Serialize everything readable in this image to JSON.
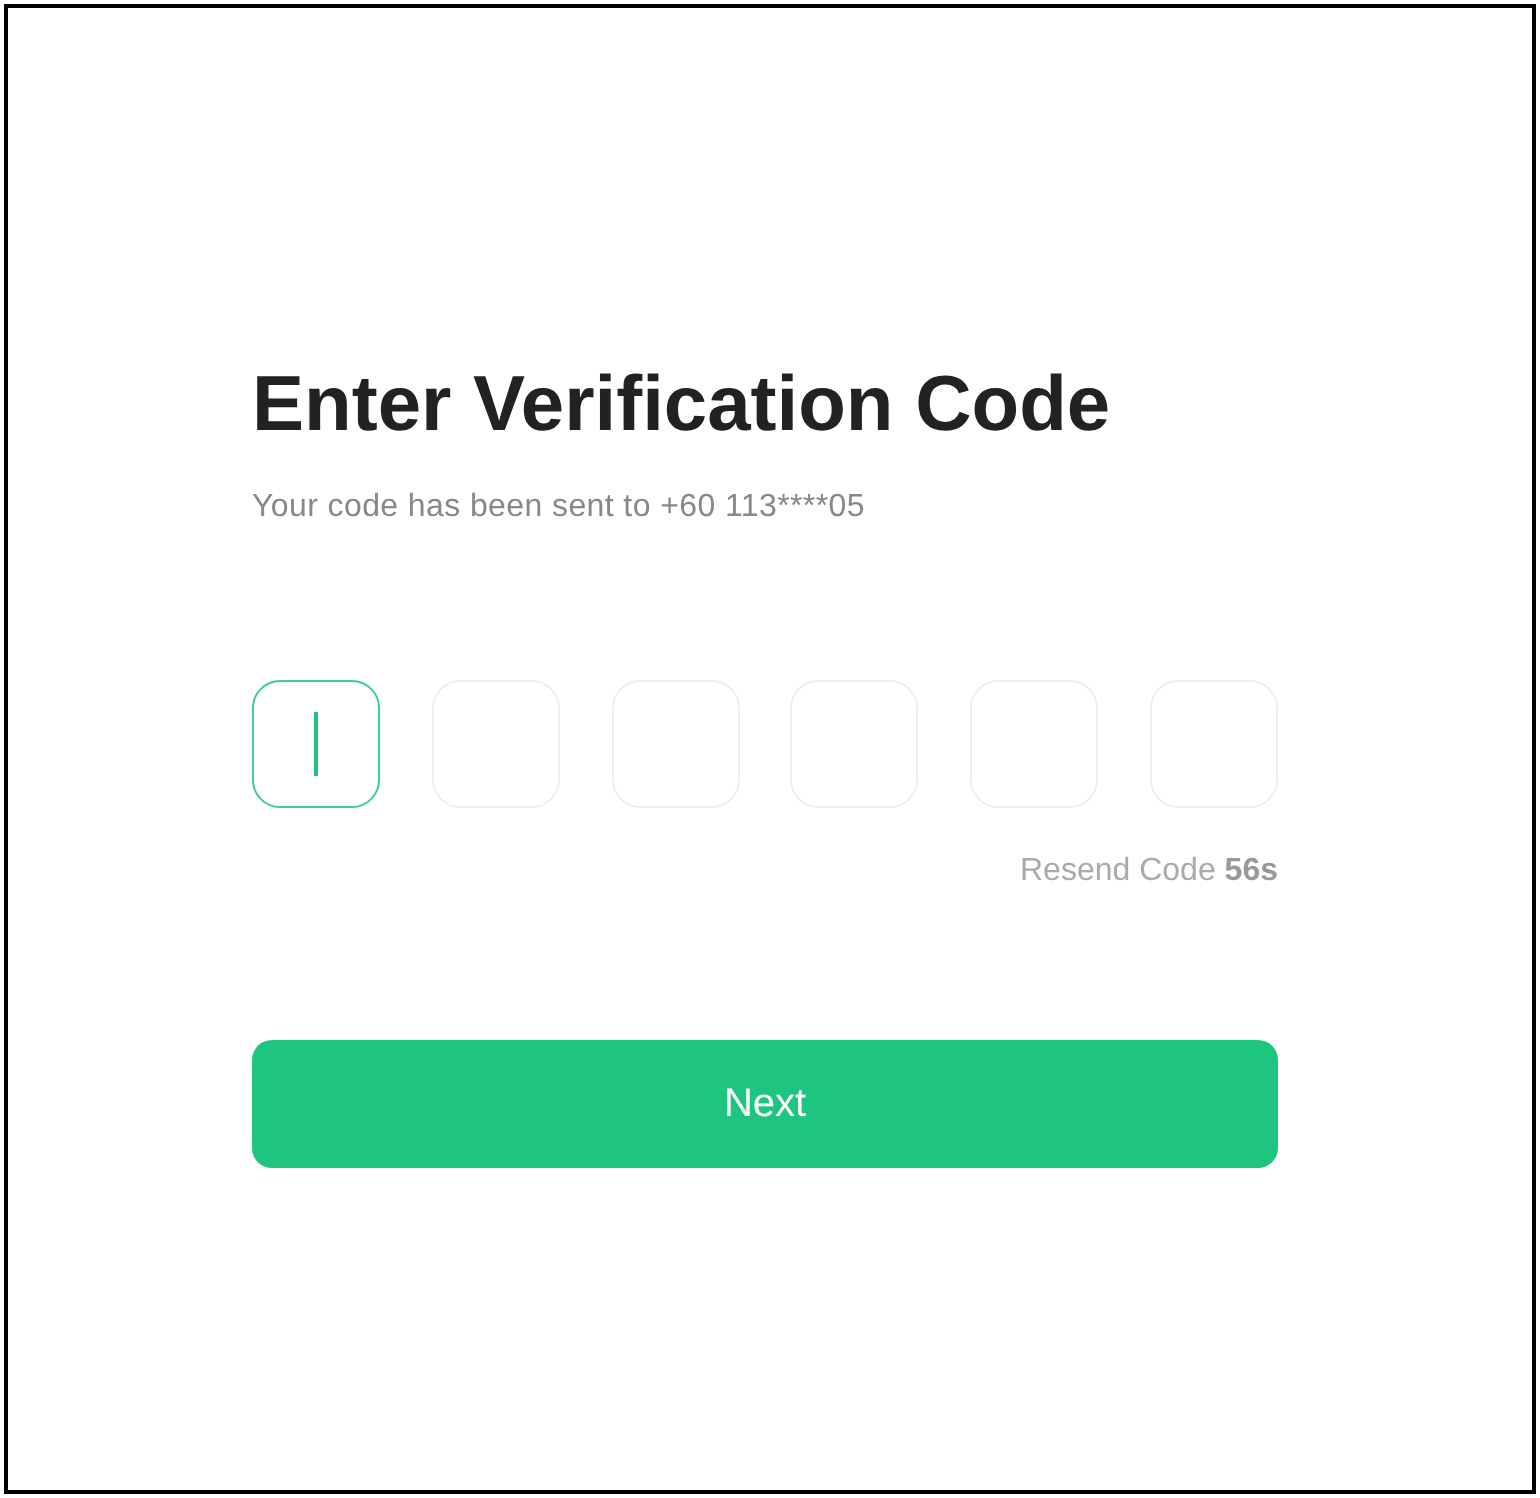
{
  "title": "Enter Verification Code",
  "subtitle": "Your code has been sent to +60 113****05",
  "code_boxes": [
    {
      "focused": true
    },
    {
      "focused": false
    },
    {
      "focused": false
    },
    {
      "focused": false
    },
    {
      "focused": false
    },
    {
      "focused": false
    }
  ],
  "resend": {
    "label": "Resend Code",
    "countdown": "56s"
  },
  "next_button": {
    "label": "Next"
  }
}
